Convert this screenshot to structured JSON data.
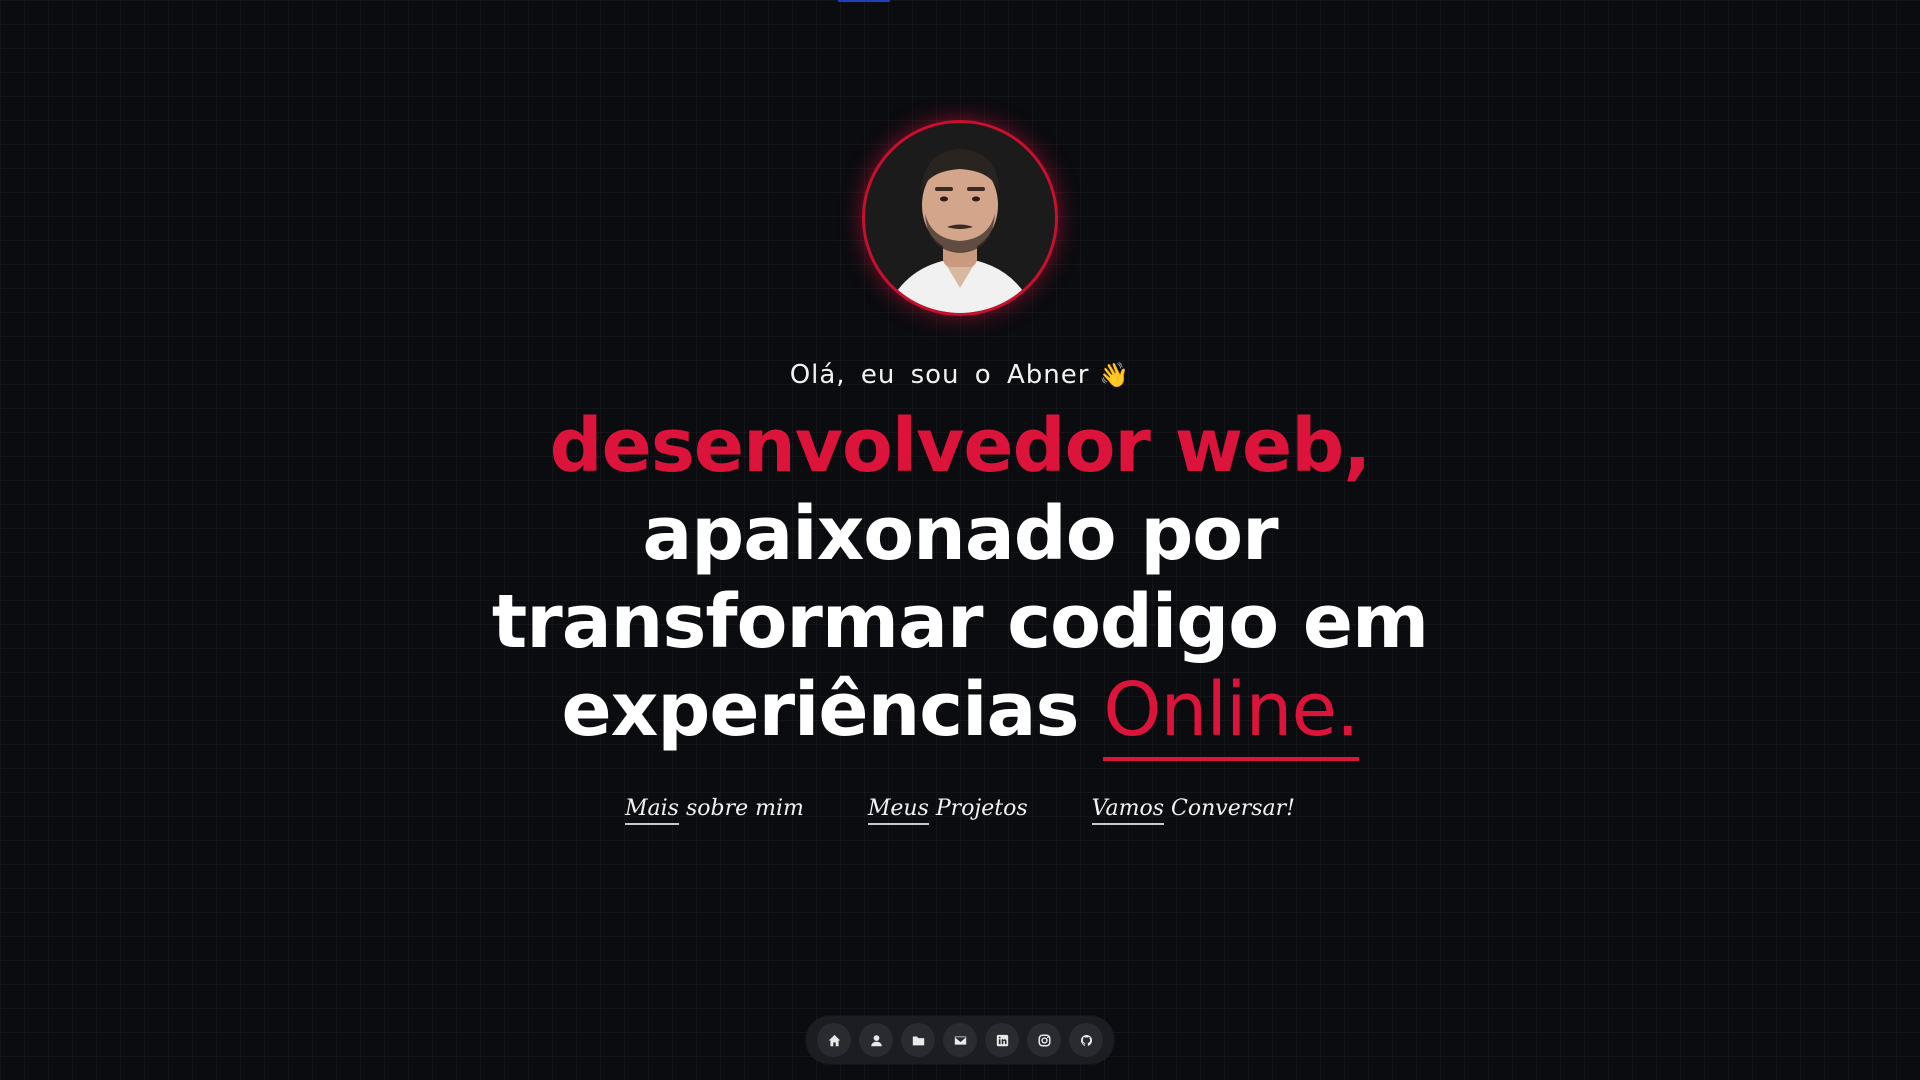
{
  "hero": {
    "greeting": "Olá, eu sou o Abner",
    "greeting_emoji": "👋",
    "headline_line1": "desenvolvedor web,",
    "headline_line2": "apaixonado por",
    "headline_line3": "transformar codigo em",
    "headline_line4_prefix": "experiências",
    "headline_line4_accent": "Online."
  },
  "links": [
    {
      "first": "Mais",
      "rest": " sobre mim"
    },
    {
      "first": "Meus",
      "rest": " Projetos"
    },
    {
      "first": "Vamos",
      "rest": " Conversar!"
    }
  ],
  "dock": [
    {
      "icon": "home-icon"
    },
    {
      "icon": "user-icon"
    },
    {
      "icon": "folder-icon"
    },
    {
      "icon": "mail-icon"
    },
    {
      "icon": "linkedin-icon"
    },
    {
      "icon": "instagram-icon"
    },
    {
      "icon": "github-icon"
    }
  ],
  "colors": {
    "accent": "#dc143c",
    "background": "#0b0c10",
    "text": "#ffffff"
  }
}
